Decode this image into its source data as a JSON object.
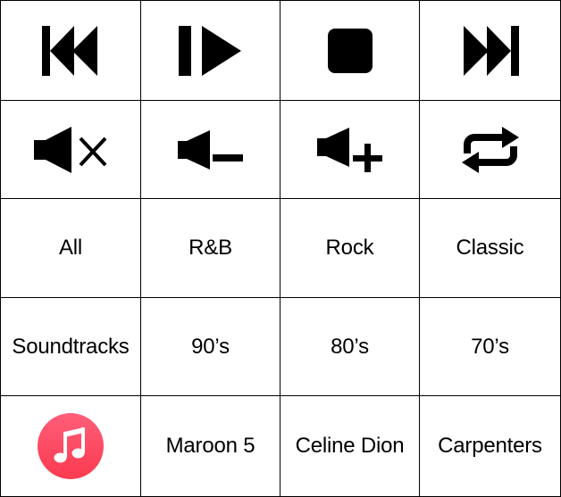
{
  "controls": {
    "rewind_icon": "rewind-icon",
    "play_pause_icon": "play-pause-icon",
    "stop_icon": "stop-icon",
    "fast_forward_icon": "fast-forward-icon",
    "mute_icon": "mute-icon",
    "volume_down_icon": "volume-down-icon",
    "volume_up_icon": "volume-up-icon",
    "repeat_icon": "repeat-icon"
  },
  "genres": [
    "All",
    "R&B",
    "Rock",
    "Classic"
  ],
  "decades": [
    "Soundtracks",
    "90’s",
    "80’s",
    "70’s"
  ],
  "artists": [
    "Maroon 5",
    "Celine Dion",
    "Carpenters"
  ],
  "app_icon": {
    "name": "music-app-icon",
    "gradient_top": "#ff5e7a",
    "gradient_bottom": "#fb3a4f"
  }
}
